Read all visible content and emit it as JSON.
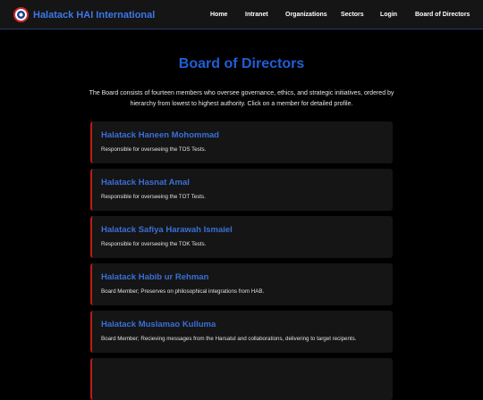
{
  "header": {
    "site_name": "Halatack HAI International",
    "logo_icon": "halatack-logo-icon",
    "nav": {
      "home": "Home",
      "intranet": "Intranet",
      "organizations": "Organizations",
      "sectors": "Sectors",
      "login": "Login",
      "board": "Board of Directors"
    }
  },
  "main": {
    "title": "Board of Directors",
    "intro": "The Board consists of fourteen members who oversee governance, ethics, and strategic initiatives, ordered by hierarchy from lowest to highest authority. Click on a member for detailed profile.",
    "members": [
      {
        "name": "Halatack Haneen Mohommad",
        "role": "Responsible for overseeing the TOS Tests."
      },
      {
        "name": "Halatack Hasnat Amal",
        "role": "Responsible for overseeing the TOT Tests."
      },
      {
        "name": "Halatack Safiya Harawah Ismaiel",
        "role": "Responsible for overseeing the TOK Tests."
      },
      {
        "name": "Halatack Habib ur Rehman",
        "role": "Board Member; Preserves on philosophical integrations from HAB."
      },
      {
        "name": "Halatack Muslamao Kulluma",
        "role": "Board Member; Recieving messages from the Harsatul and collaborations, delivering to target recipents."
      },
      {
        "name": "",
        "role": ""
      }
    ]
  },
  "colors": {
    "background": "#000000",
    "accent_blue": "#1f5fd6",
    "card_border_red": "#b71c1c",
    "card_background": "#151515"
  }
}
